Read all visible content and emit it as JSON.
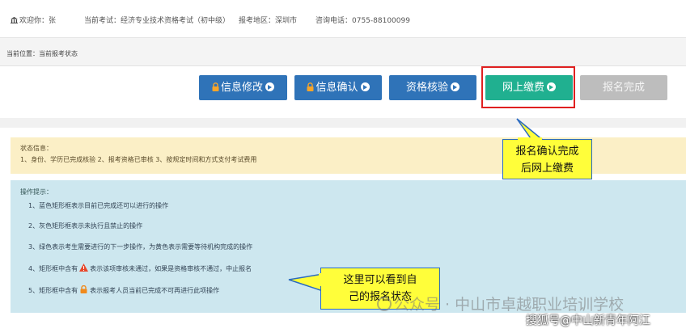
{
  "header": {
    "welcome": "欢迎你：张",
    "exam": "当前考试：经济专业技术资格考试（初中级）",
    "region": "报考地区：深圳市",
    "phone": "咨询电话：0755-88100099"
  },
  "breadcrumb": "当前位置：当前报考状态",
  "steps": [
    {
      "label": "信息修改",
      "state": "done",
      "locked": true
    },
    {
      "label": "信息确认",
      "state": "done",
      "locked": true
    },
    {
      "label": "资格核验",
      "state": "done",
      "locked": false
    },
    {
      "label": "网上缴费",
      "state": "next",
      "locked": false
    },
    {
      "label": "报名完成",
      "state": "disabled",
      "locked": false
    }
  ],
  "status": {
    "title": "状态信息：",
    "text": "1、身份、学历已完成核验 2、报考资格已审核 3、按规定时间和方式支付考试费用"
  },
  "ops": {
    "title": "操作提示：",
    "line1": "1、蓝色矩形框表示目前已完成还可以进行的操作",
    "line2": "2、灰色矩形框表示未执行且禁止的操作",
    "line3": "3、绿色表示考生需要进行的下一步操作，为黄色表示需要等待机构完成的操作",
    "line4_pre": "4、矩形框中含有",
    "line4_post": "表示该项审核未通过，如果是资格审核不通过，中止报名",
    "line5_pre": "5、矩形框中含有",
    "line5_post": "表示报考人员当前已完成不可再进行此项操作"
  },
  "callouts": {
    "c1_line1": "报名确认完成",
    "c1_line2": "后网上缴费",
    "c2_line1": "这里可以看到自",
    "c2_line2": "己的报名状态"
  },
  "watermark": {
    "wechat": "公众号 · 中山市卓越职业培训学校",
    "sohu": "搜狐号@中山新青年阿江"
  },
  "colors": {
    "blue": "#2f73b8",
    "green": "#20b090",
    "gray": "#bdbdbd",
    "status_bg": "#fbefc6",
    "ops_bg": "#cde7ef",
    "callout_bg": "#fffe3a",
    "highlight": "#e02020"
  }
}
